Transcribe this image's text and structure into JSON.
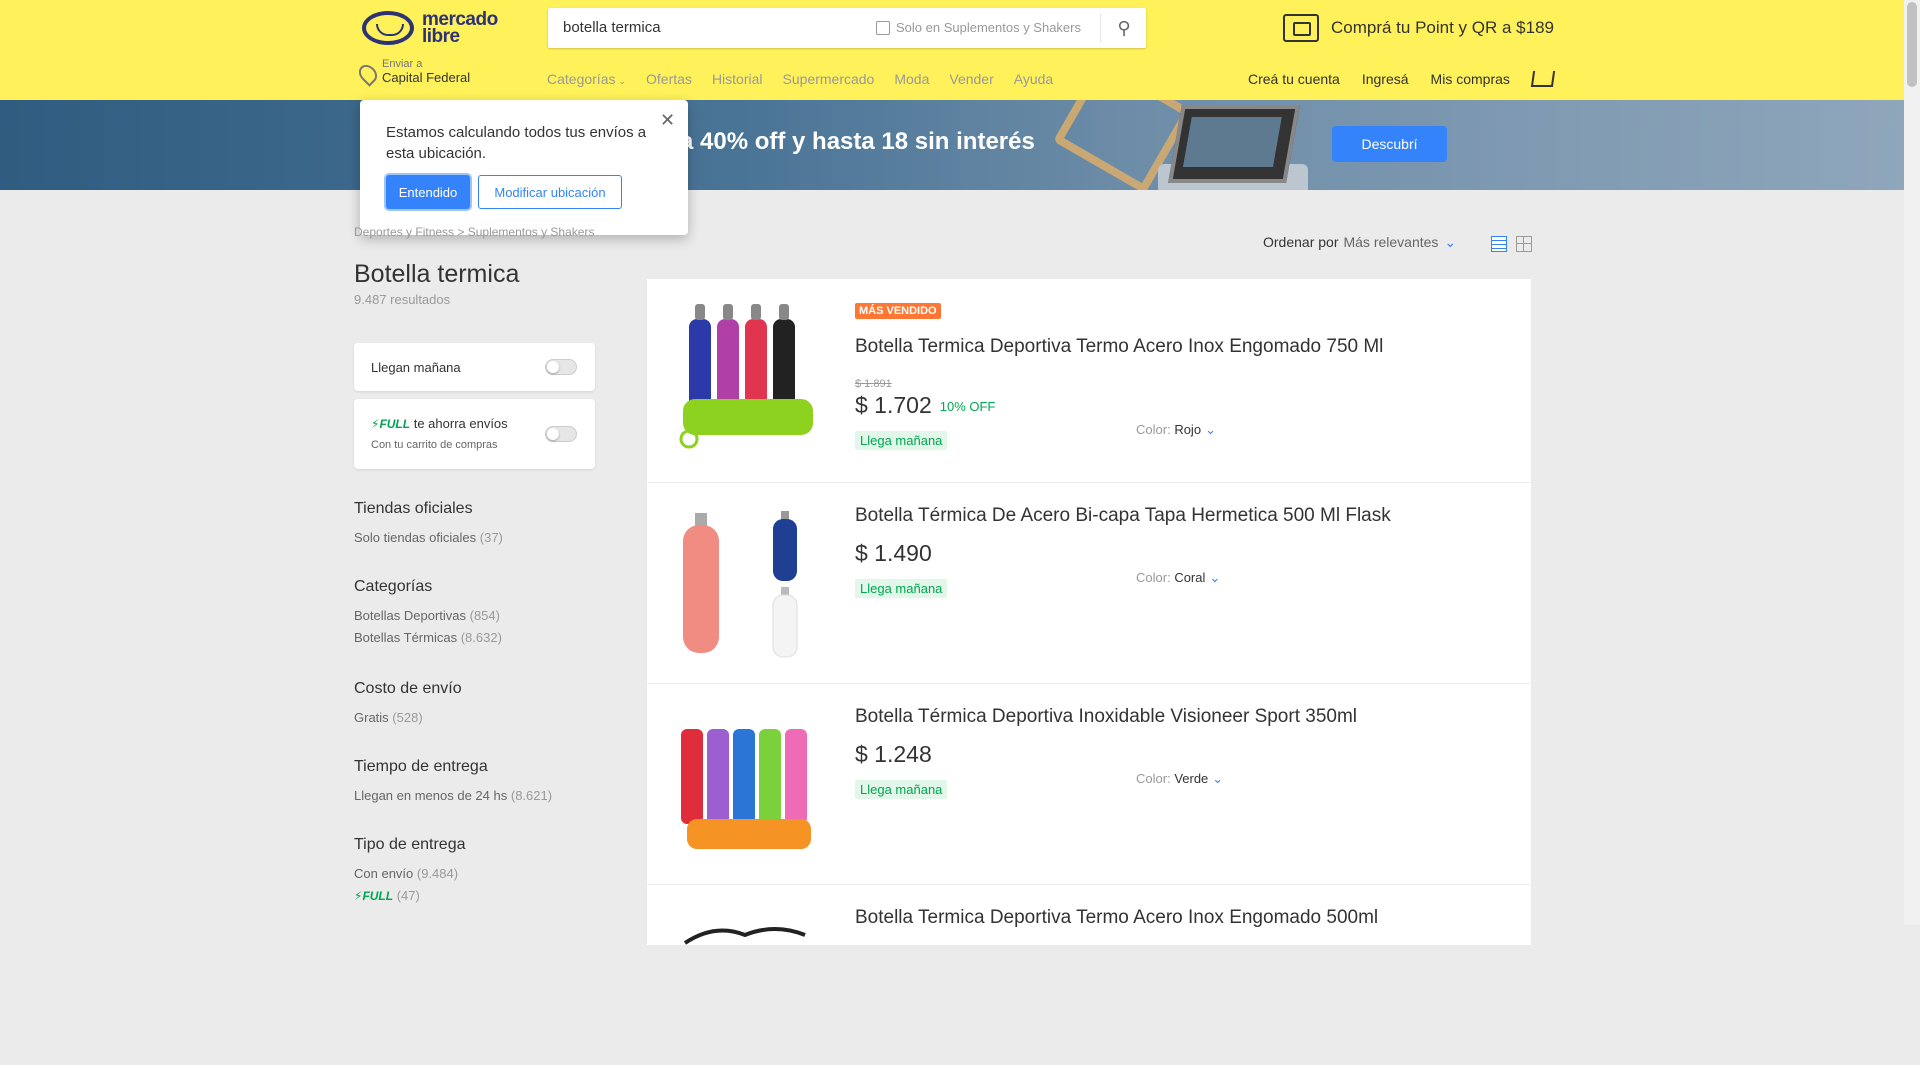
{
  "header": {
    "logo_text": "mercado\nlibre",
    "search_query": "botella termica",
    "search_filter_label": "Solo en Suplementos y Shakers",
    "promo": "Comprá tu Point y QR a $189",
    "location_label": "Enviar a",
    "location_value": "Capital Federal",
    "nav": [
      "Categorías",
      "Ofertas",
      "Historial",
      "Supermercado",
      "Moda",
      "Vender",
      "Ayuda"
    ],
    "user_nav": [
      "Creá tu cuenta",
      "Ingresá",
      "Mis compras"
    ]
  },
  "banner": {
    "text": "a 40% off y hasta 18 sin interés",
    "cta": "Descubrí"
  },
  "popup": {
    "message": "Estamos calculando todos tus envíos a esta ubicación.",
    "ok_label": "Entendido",
    "modify_label": "Modificar ubicación"
  },
  "sidebar": {
    "breadcrumb": "Deportes y Fitness > Suplementos y Shakers",
    "title": "Botella termica",
    "results": "9.487 resultados",
    "toggle_tomorrow": "Llegan mañana",
    "full_badge": "FULL",
    "full_text": "te ahorra envíos",
    "full_sub": "Con tu carrito de compras",
    "sections": [
      {
        "title": "Tiendas oficiales",
        "items": [
          {
            "label": "Solo tiendas oficiales",
            "qty": "(37)"
          }
        ]
      },
      {
        "title": "Categorías",
        "items": [
          {
            "label": "Botellas Deportivas",
            "qty": "(854)"
          },
          {
            "label": "Botellas Térmicas",
            "qty": "(8.632)"
          }
        ]
      },
      {
        "title": "Costo de envío",
        "items": [
          {
            "label": "Gratis",
            "qty": "(528)"
          }
        ]
      },
      {
        "title": "Tiempo de entrega",
        "items": [
          {
            "label": "Llegan en menos de 24 hs",
            "qty": "(8.621)"
          }
        ]
      },
      {
        "title": "Tipo de entrega",
        "items": [
          {
            "label": "Con envío",
            "qty": "(9.484)"
          },
          {
            "label": "FULL",
            "qty": "(47)"
          }
        ]
      }
    ]
  },
  "sort": {
    "label": "Ordenar por",
    "value": "Más relevantes"
  },
  "results": [
    {
      "badge": "MÁS VENDIDO",
      "title": "Botella Termica Deportiva Termo Acero Inox Engomado 750 Ml",
      "old_price": "$ 1.891",
      "price": "$ 1.702",
      "discount": "10% OFF",
      "shipping": "Llega mañana",
      "color_label": "Color:",
      "color_value": "Rojo"
    },
    {
      "title": "Botella Térmica De Acero Bi-capa Tapa Hermetica 500 Ml Flask",
      "price": "$ 1.490",
      "shipping": "Llega mañana",
      "color_label": "Color:",
      "color_value": "Coral"
    },
    {
      "title": "Botella Térmica Deportiva Inoxidable Visioneer Sport 350ml",
      "price": "$ 1.248",
      "shipping": "Llega mañana",
      "color_label": "Color:",
      "color_value": "Verde"
    },
    {
      "title": "Botella Termica Deportiva Termo Acero Inox Engomado 500ml"
    }
  ]
}
